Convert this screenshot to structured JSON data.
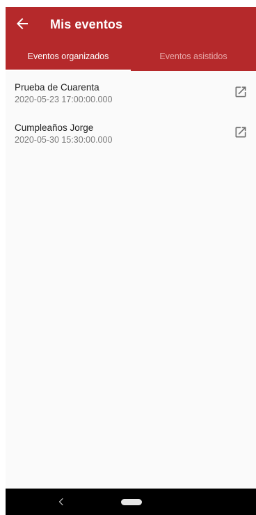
{
  "app_bar": {
    "title": "Mis eventos",
    "back_icon": "arrow-left-icon",
    "background": "#b5292b"
  },
  "tabs": [
    {
      "label": "Eventos organizados",
      "active": true
    },
    {
      "label": "Eventos asistidos",
      "active": false
    }
  ],
  "events": [
    {
      "name": "Prueba de Cuarenta",
      "datetime": "2020-05-23 17:00:00.000",
      "action_icon": "open-in-new-icon"
    },
    {
      "name": "Cumpleaños Jorge",
      "datetime": "2020-05-30 15:30:00.000",
      "action_icon": "open-in-new-icon"
    }
  ],
  "nav_bar": {
    "back_icon": "chevron-left-icon",
    "home_icon": "home-pill-icon"
  }
}
